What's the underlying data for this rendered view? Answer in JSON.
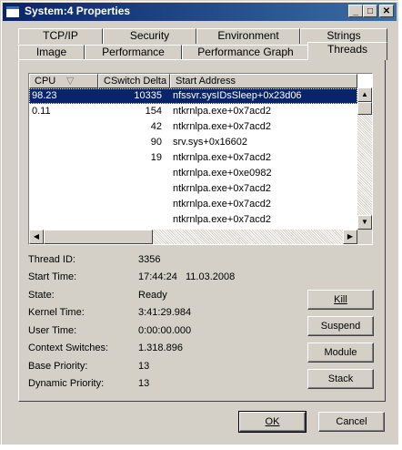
{
  "window": {
    "title": "System:4 Properties"
  },
  "titlebar_buttons": {
    "minimize": "_",
    "maximize": "□",
    "close": "✕"
  },
  "tabs_row1": [
    "TCP/IP",
    "Security",
    "Environment",
    "Strings"
  ],
  "tabs_row2": [
    "Image",
    "Performance",
    "Performance Graph",
    "Threads"
  ],
  "active_tab": "Threads",
  "threads_list": {
    "columns": [
      "CPU",
      "CSwitch Delta",
      "Start Address"
    ],
    "sort_indicator": "▽",
    "rows": [
      {
        "cpu": "98.23",
        "cswitch": "10335",
        "address": "nfssvr.sysIDsSleep+0x23d06"
      },
      {
        "cpu": "0.11",
        "cswitch": "154",
        "address": "ntkrnlpa.exe+0x7acd2"
      },
      {
        "cpu": "",
        "cswitch": "42",
        "address": "ntkrnlpa.exe+0x7acd2"
      },
      {
        "cpu": "",
        "cswitch": "90",
        "address": "srv.sys+0x16602"
      },
      {
        "cpu": "",
        "cswitch": "19",
        "address": "ntkrnlpa.exe+0x7acd2"
      },
      {
        "cpu": "",
        "cswitch": "",
        "address": "ntkrnlpa.exe+0xe0982"
      },
      {
        "cpu": "",
        "cswitch": "",
        "address": "ntkrnlpa.exe+0x7acd2"
      },
      {
        "cpu": "",
        "cswitch": "",
        "address": "ntkrnlpa.exe+0x7acd2"
      },
      {
        "cpu": "",
        "cswitch": "",
        "address": "ntkrnlpa.exe+0x7acd2"
      }
    ]
  },
  "details": {
    "thread_id_label": "Thread ID:",
    "thread_id": "3356",
    "start_time_label": "Start Time:",
    "start_time": "17:44:24   11.03.2008",
    "state_label": "State:",
    "state": "Ready",
    "kernel_time_label": "Kernel Time:",
    "kernel_time": "3:41:29.984",
    "user_time_label": "User Time:",
    "user_time": "0:00:00.000",
    "context_switches_label": "Context Switches:",
    "context_switches": "1.318.896",
    "base_priority_label": "Base Priority:",
    "base_priority": "13",
    "dynamic_priority_label": "Dynamic Priority:",
    "dynamic_priority": "13"
  },
  "actions": {
    "kill": "Kill",
    "suspend": "Suspend",
    "module": "Module",
    "stack": "Stack"
  },
  "dialog": {
    "ok": "OK",
    "cancel": "Cancel"
  }
}
